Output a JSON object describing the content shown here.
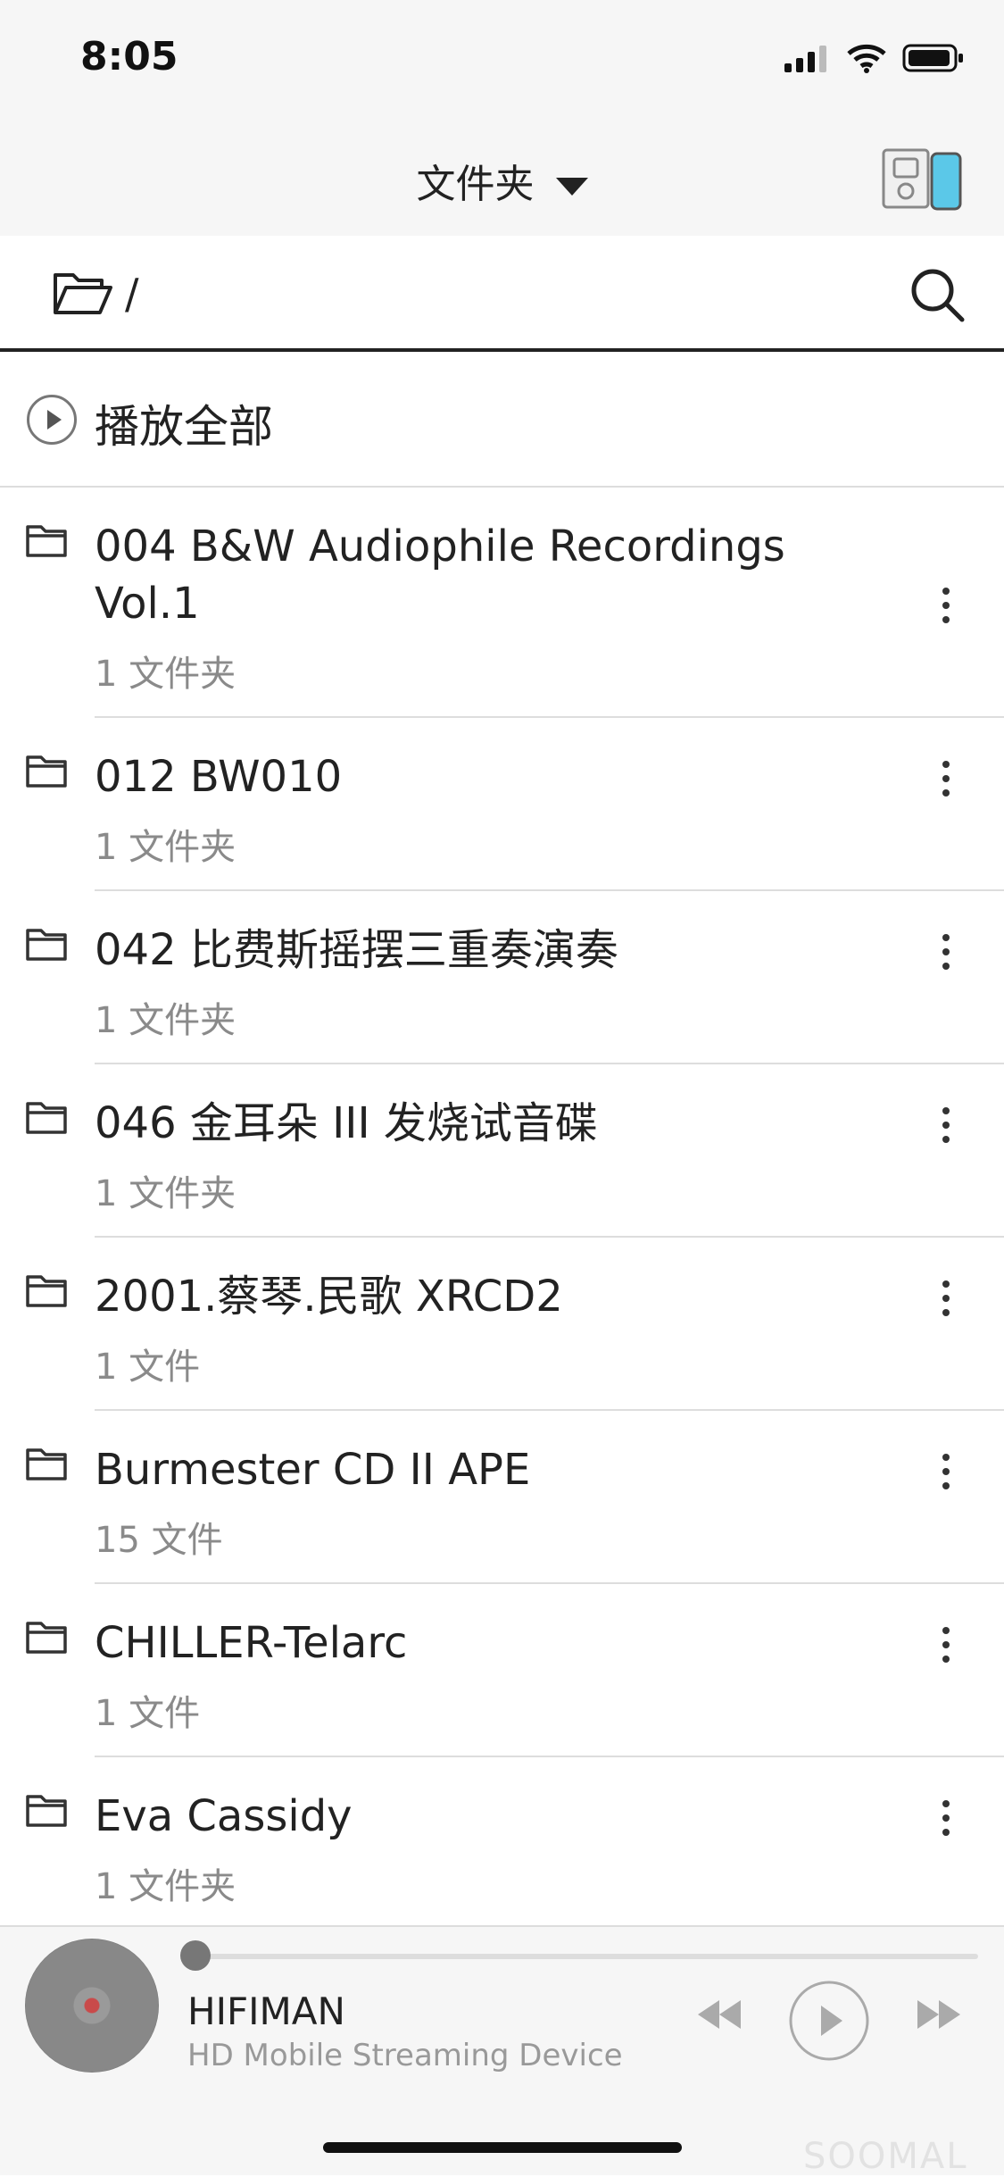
{
  "status_bar": {
    "time": "8:05"
  },
  "nav": {
    "title": "文件夹"
  },
  "path": {
    "current": "/"
  },
  "play_all": {
    "label": "播放全部"
  },
  "folders": [
    {
      "title": "004 B&W Audiophile Recordings Vol.1",
      "subtitle": "1 文件夹"
    },
    {
      "title": "012 BW010",
      "subtitle": "1 文件夹"
    },
    {
      "title": "042 比费斯摇摆三重奏演奏",
      "subtitle": "1 文件夹"
    },
    {
      "title": "046 金耳朵 III 发烧试音碟",
      "subtitle": "1 文件夹"
    },
    {
      "title": "2001.蔡琴.民歌 XRCD2",
      "subtitle": "1 文件"
    },
    {
      "title": "Burmester CD II APE",
      "subtitle": "15 文件"
    },
    {
      "title": "CHILLER-Telarc",
      "subtitle": "1 文件"
    },
    {
      "title": "Eva Cassidy",
      "subtitle": "1 文件夹"
    }
  ],
  "player": {
    "title": "HIFIMAN",
    "subtitle": "HD Mobile Streaming Device",
    "progress": 0
  },
  "watermark": "SOOMAL",
  "colors": {
    "accent": "#5bc8e8",
    "bars": "#f6f6f6"
  }
}
